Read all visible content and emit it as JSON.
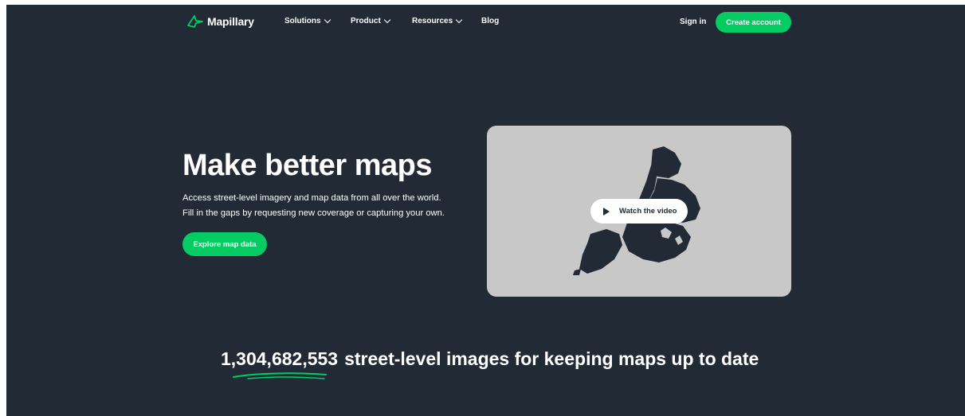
{
  "brand": {
    "name": "Mapillary",
    "accent": "#05cb63",
    "background": "#212a35"
  },
  "nav": {
    "items": [
      {
        "label": "Solutions",
        "dropdown": true
      },
      {
        "label": "Product",
        "dropdown": true
      },
      {
        "label": "Resources",
        "dropdown": true
      },
      {
        "label": "Blog",
        "dropdown": false
      }
    ],
    "sign_in": "Sign in",
    "create_account": "Create account"
  },
  "hero": {
    "title": "Make better maps",
    "subtitle_line1": "Access street-level imagery and map data from all over the world.",
    "subtitle_line2": "Fill in the gaps by requesting new coverage or capturing your own.",
    "cta": "Explore map data",
    "video_button": "Watch the video"
  },
  "stats": {
    "count": "1,304,682,553",
    "text": "street-level images for keeping maps up to date"
  },
  "icons": {
    "logo": "mapillary-logo-icon",
    "chevron": "chevron-down-icon",
    "play": "play-icon"
  }
}
